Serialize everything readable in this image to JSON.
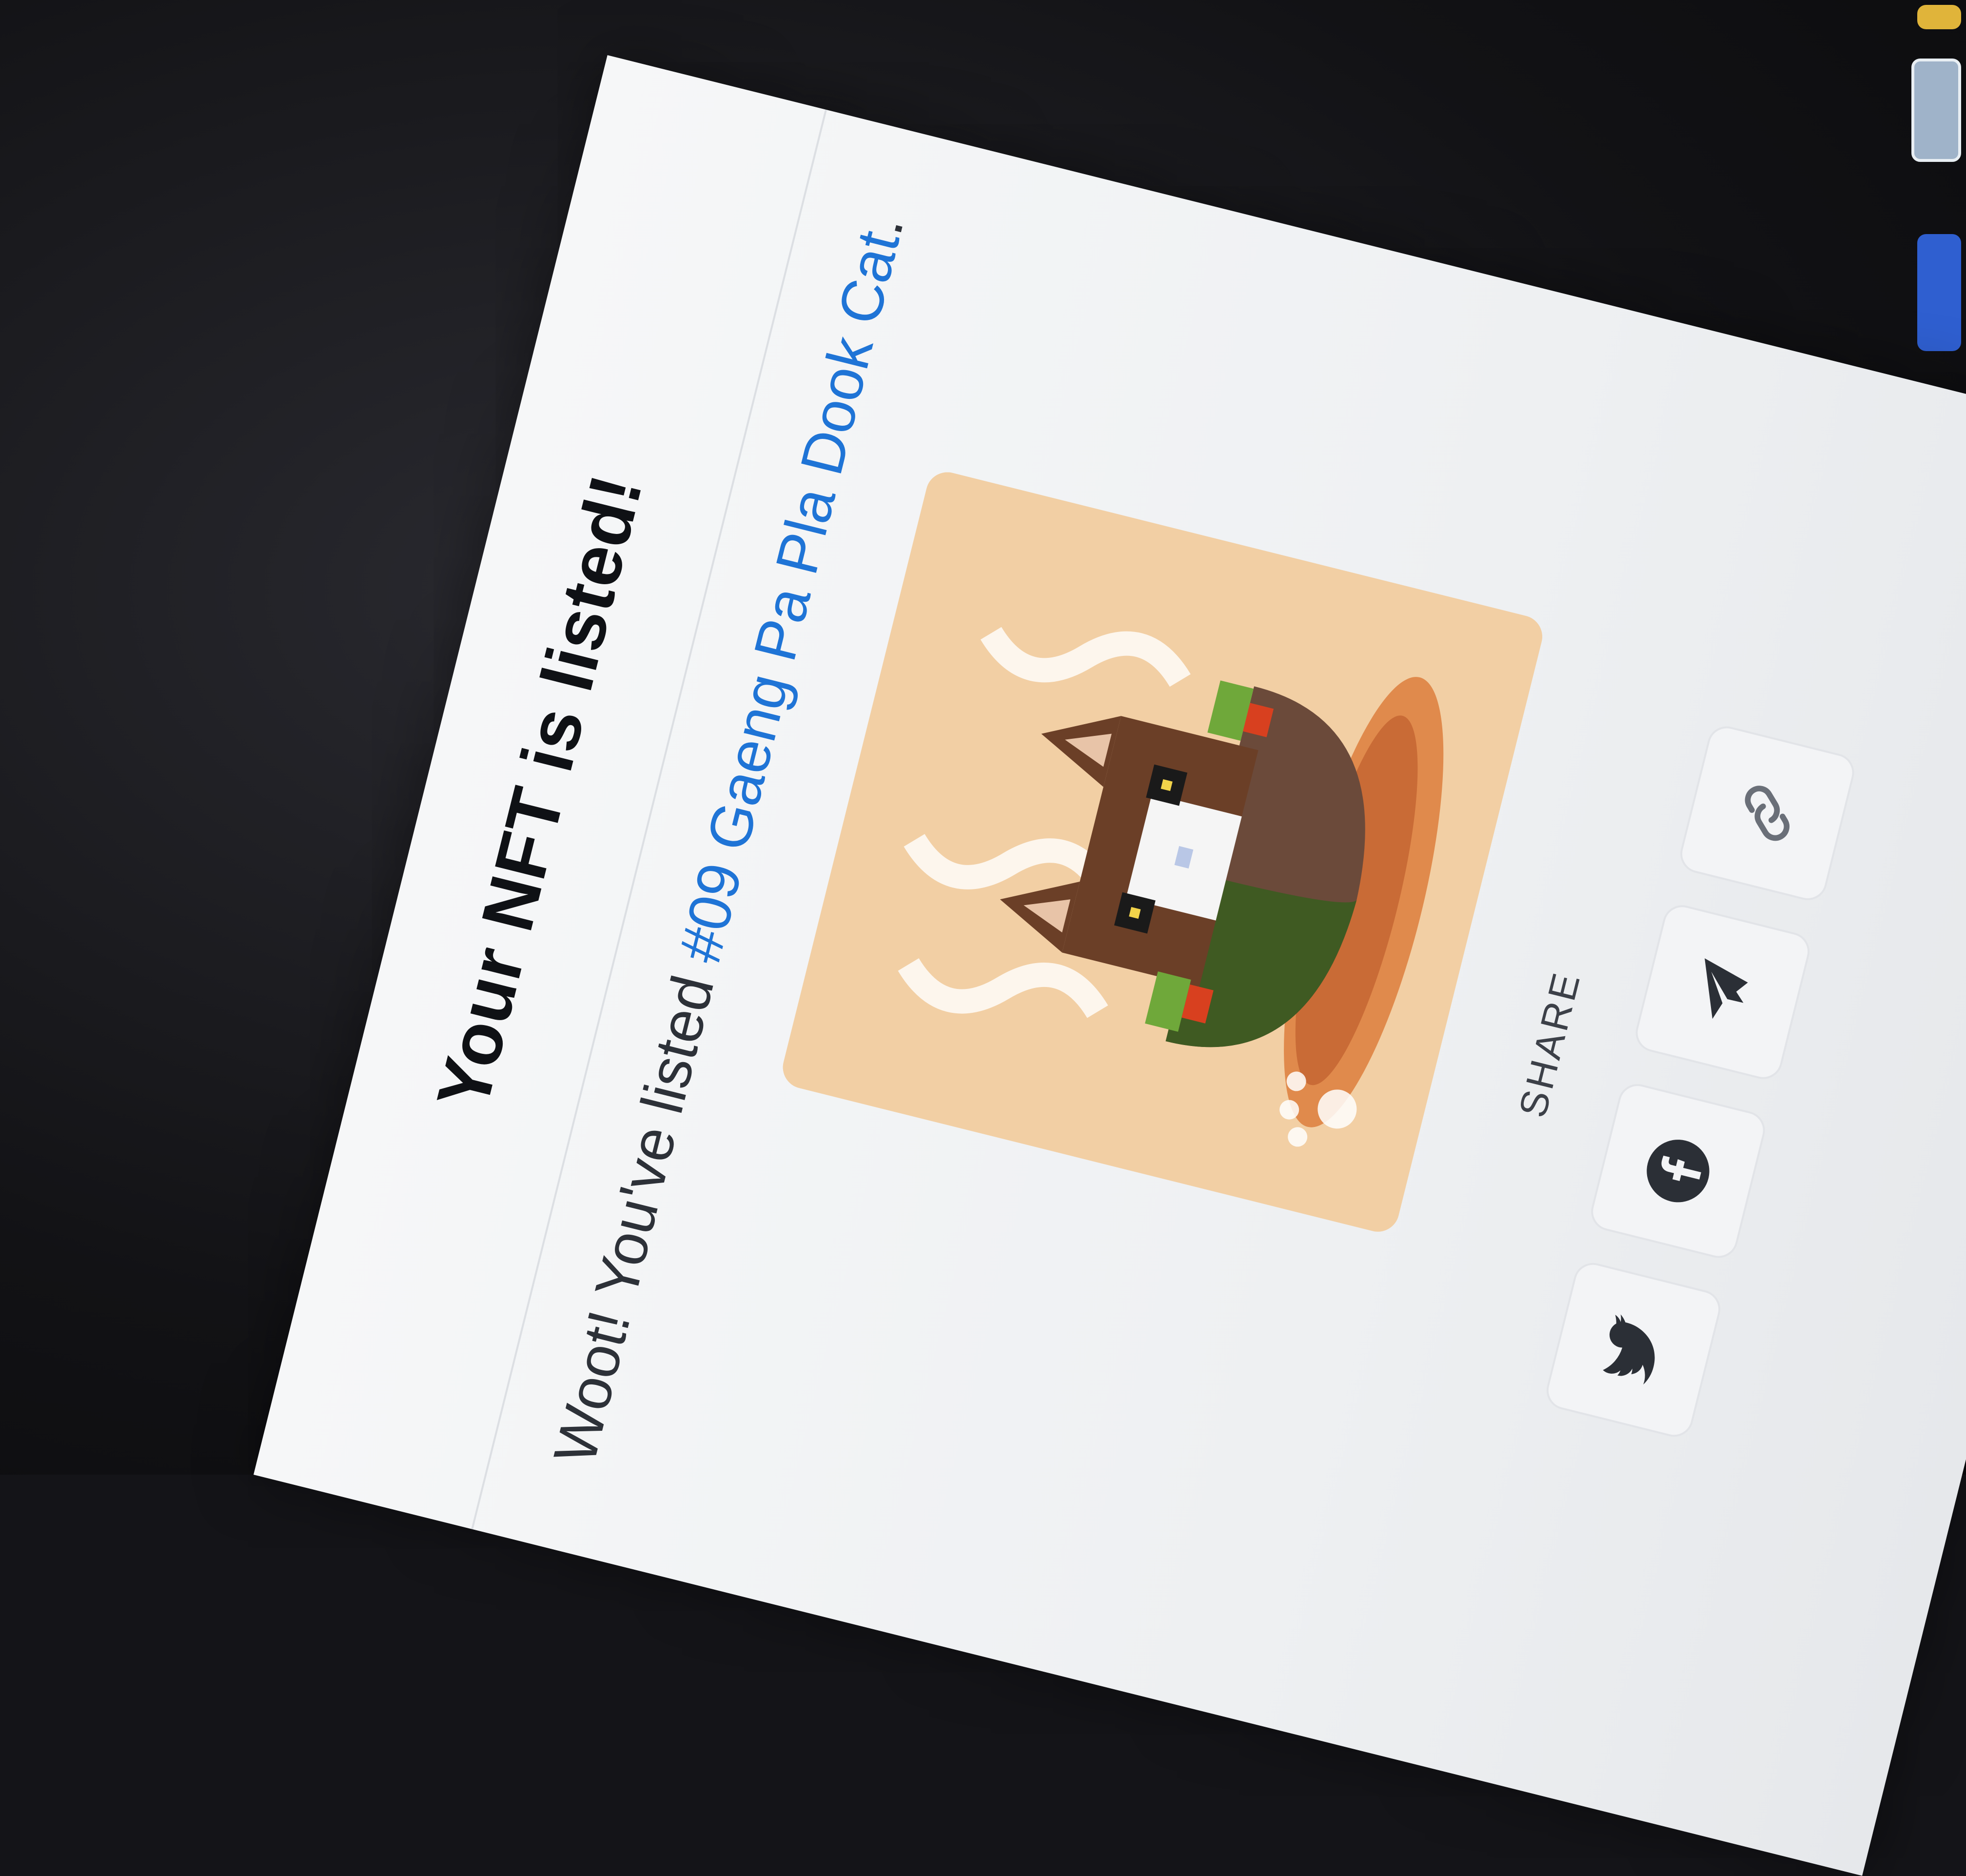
{
  "modal": {
    "title": "Your NFT is listed!",
    "message_prefix": "Woot! You've listed ",
    "nft_name": "#09 Gaeng Pa Pla Dook Cat",
    "message_suffix": ".",
    "image_alt": "Pixel art cat in a bowl of curry",
    "share_label": "SHARE",
    "share_buttons": [
      {
        "name": "twitter",
        "icon": "twitter-icon"
      },
      {
        "name": "facebook",
        "icon": "facebook-icon"
      },
      {
        "name": "telegram",
        "icon": "telegram-icon"
      },
      {
        "name": "copy-link",
        "icon": "link-icon"
      }
    ]
  },
  "colors": {
    "accent_link": "#1f74d6",
    "title_text": "#0f1115",
    "card_background": "#f2cfa4"
  }
}
